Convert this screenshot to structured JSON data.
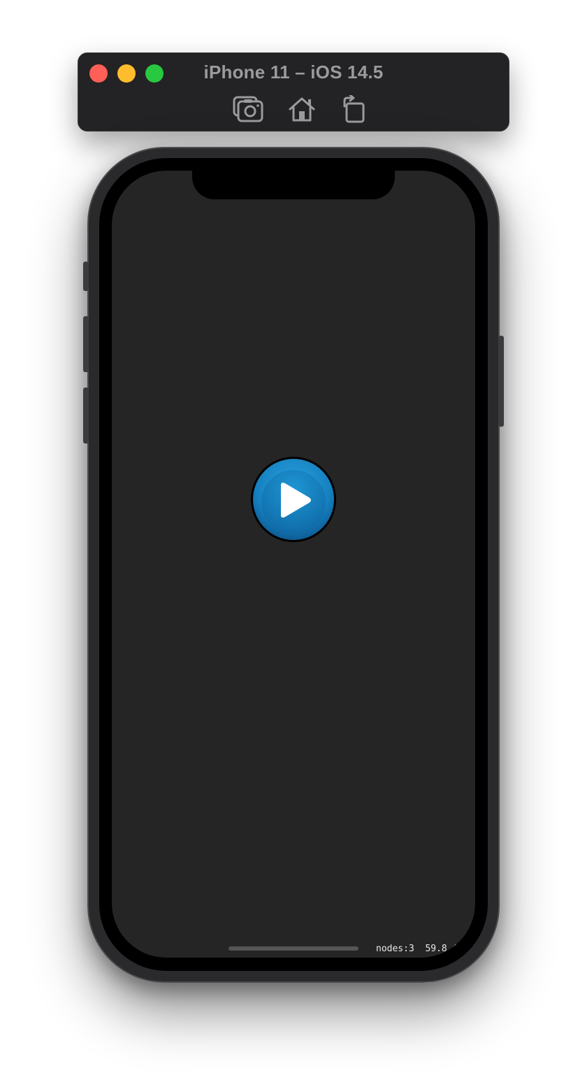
{
  "window": {
    "title": "iPhone 11 – iOS 14.5",
    "traffic_lights": {
      "close_color": "#fe5f57",
      "minimize_color": "#febc2e",
      "zoom_color": "#28c840"
    },
    "toolbar": {
      "screenshot_icon": "camera-icon",
      "home_icon": "home-icon",
      "rotate_icon": "rotate-icon"
    }
  },
  "device": {
    "screen_background": "#252525",
    "play_button": {
      "icon": "play-icon",
      "color": "#1a8ccc"
    },
    "stats_overlay": "nodes:3  59.8 fps"
  }
}
